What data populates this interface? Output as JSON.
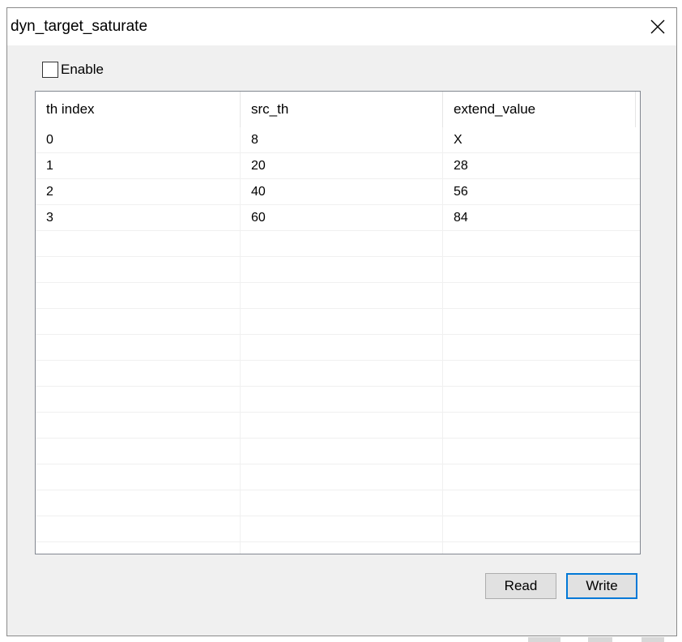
{
  "window": {
    "title": "dyn_target_saturate",
    "close_icon": "close-x-icon"
  },
  "enable": {
    "label": "Enable",
    "checked": false
  },
  "table": {
    "columns": [
      "th index",
      "src_th",
      "extend_value"
    ],
    "rows": [
      [
        "0",
        "8",
        "X"
      ],
      [
        "1",
        "20",
        "28"
      ],
      [
        "2",
        "40",
        "56"
      ],
      [
        "3",
        "60",
        "84"
      ]
    ]
  },
  "buttons": {
    "read_label": "Read",
    "write_label": "Write"
  },
  "colors": {
    "accent": "#0078d7",
    "dialog_bg": "#f0f0f0",
    "list_bg": "#ffffff"
  }
}
